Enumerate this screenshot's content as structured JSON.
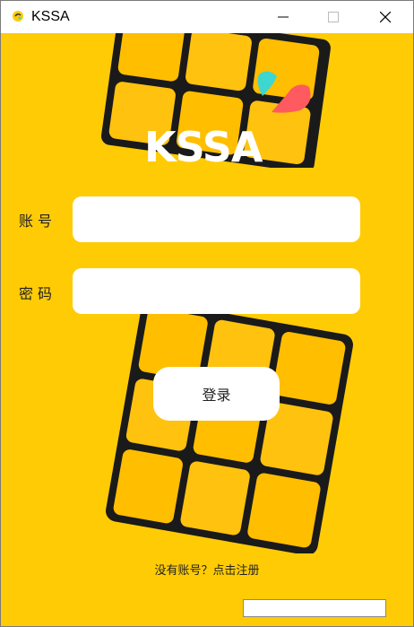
{
  "window": {
    "title": "KSSA",
    "icon": "app-logo-icon",
    "controls": [
      "minimize-icon",
      "maximize-icon",
      "close-icon"
    ]
  },
  "brand": {
    "logo_text": "KSSA",
    "colors": {
      "background": "#FFCB05",
      "drop_cyan": "#3DD6D0",
      "drop_red": "#FF5A5F"
    }
  },
  "form": {
    "account_label": "账号",
    "account_value": "",
    "password_label": "密码",
    "password_value": "",
    "login_button": "登录"
  },
  "footer": {
    "register_link": "没有账号？点击注册"
  }
}
